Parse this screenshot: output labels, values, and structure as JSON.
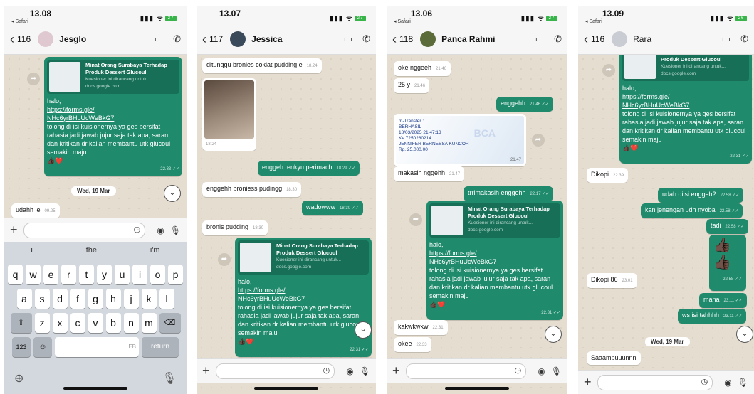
{
  "phones": [
    {
      "time": "13.08",
      "safari": "◂ Safari",
      "signal": "▮▮▮ ᯤ",
      "battery": "27",
      "back_count": "116",
      "contact": "Jesglo",
      "card": {
        "preview_title": "Minat Orang Surabaya Terhadap Produk Dessert Glucoul",
        "preview_desc": "Kuesioner ini dirancang untuk...",
        "preview_domain": "docs.google.com",
        "greeting": "halo,",
        "link1": "https://forms.gle/",
        "link2": "NHc6yrBHuUcWeBkG7",
        "body": "tolong di isi kuisionernya ya ges bersifat rahasia jadi jawab jujur saja tak apa, saran dan kritikan dr kalian membantu utk glucoul semakin maju",
        "emoji": "👍🏿❤️",
        "time": "22.33 ✓✓"
      },
      "date_chip": "Wed, 19 Mar",
      "messages": [
        {
          "text": "udahh je",
          "time": "09.25"
        }
      ],
      "keyboard": {
        "suggestions": [
          "i",
          "the",
          "i'm"
        ],
        "row1": [
          "q",
          "w",
          "e",
          "r",
          "t",
          "y",
          "u",
          "i",
          "o",
          "p"
        ],
        "row2": [
          "a",
          "s",
          "d",
          "f",
          "g",
          "h",
          "j",
          "k",
          "l"
        ],
        "row3": [
          "z",
          "x",
          "c",
          "v",
          "b",
          "n",
          "m"
        ],
        "num": "123",
        "emoji": "☺",
        "space": "EB",
        "return": "return",
        "globe": "⊕",
        "mic": "🎙"
      }
    },
    {
      "time": "13.07",
      "signal": "▮▮▮ ᯤ",
      "battery": "27",
      "back_count": "117",
      "contact": "Jessica",
      "messages": [
        {
          "text": "ditunggu bronies coklat pudding e",
          "time": "18.24"
        },
        {
          "text": "",
          "time": "18.24"
        },
        {
          "text": "enggeh tenkyu perimach",
          "time": "18.29 ✓✓"
        },
        {
          "text": "enggehh broniess pudingg",
          "time": "18.30"
        },
        {
          "text": "wadowww",
          "time": "18.30 ✓✓"
        },
        {
          "text": "bronis pudding",
          "time": "18.30"
        }
      ],
      "card_time": "22.31 ✓✓"
    },
    {
      "time": "13.06",
      "safari": "◂ Safari",
      "signal": "▮▮▮ ᯤ",
      "battery": "27",
      "back_count": "118",
      "contact": "Panca Rahmi",
      "messages": [
        {
          "text": "oke nggeeh",
          "time": "21.46"
        },
        {
          "text": "25 y",
          "time": "21.46"
        },
        {
          "text": "enggehh",
          "time": "21.46 ✓✓"
        },
        {
          "text": "makasih nggehh",
          "time": "21.47"
        },
        {
          "text": "trrimakasih enggehh",
          "time": "22.17 ✓✓"
        },
        {
          "text": "kakwkwkw",
          "time": "22.31"
        },
        {
          "text": "okee",
          "time": "22.33"
        }
      ],
      "transfer": {
        "l1": "m-Transfer :",
        "l2": "BERHASIL",
        "l3": "18/03/2025 21:47:13",
        "l4": "Ke 7250280214",
        "l5": "JENNIFER BERNESSA KUNCOR",
        "l6": "Rp. 25.000,00",
        "time": "21.47",
        "bank": "BCA"
      },
      "card_time": "22.31 ✓✓"
    },
    {
      "time": "13.09",
      "safari": "◂ Safari",
      "signal": "▮▮▮ ᯤ",
      "battery": "26",
      "back_count": "116",
      "contact": "Rara",
      "messages": [
        {
          "text": "Dikopi",
          "time": "22.39"
        },
        {
          "text": "udah diisi enggeh?",
          "time": "22.58 ✓✓"
        },
        {
          "text": "kan jenengan udh nyoba",
          "time": "22.58 ✓✓"
        },
        {
          "text": "tadi",
          "time": "22.58 ✓✓"
        },
        {
          "text": "👍🏿👍🏿",
          "time": "22.58 ✓✓"
        },
        {
          "text": "Dikopi 86",
          "time": "23.01"
        },
        {
          "text": "mana",
          "time": "23.11 ✓✓"
        },
        {
          "text": "ws isi tahhhh",
          "time": "23.11 ✓✓"
        },
        {
          "text": "Saaampuuunnn",
          "time": ""
        }
      ],
      "date_chip": "Wed, 19 Mar",
      "card_time": "22.31 ✓✓"
    }
  ],
  "icons": {
    "back": "‹",
    "video": "▭",
    "phone": "✆",
    "plus": "+",
    "sticker": "◷",
    "camera": "◉",
    "mic": "🎙",
    "down": "⌄",
    "forward": "➦"
  },
  "colors": {
    "bubble_out": "#1f8a6c",
    "bubble_in": "#ffffff",
    "wallpaper": "#e6ddd1"
  }
}
